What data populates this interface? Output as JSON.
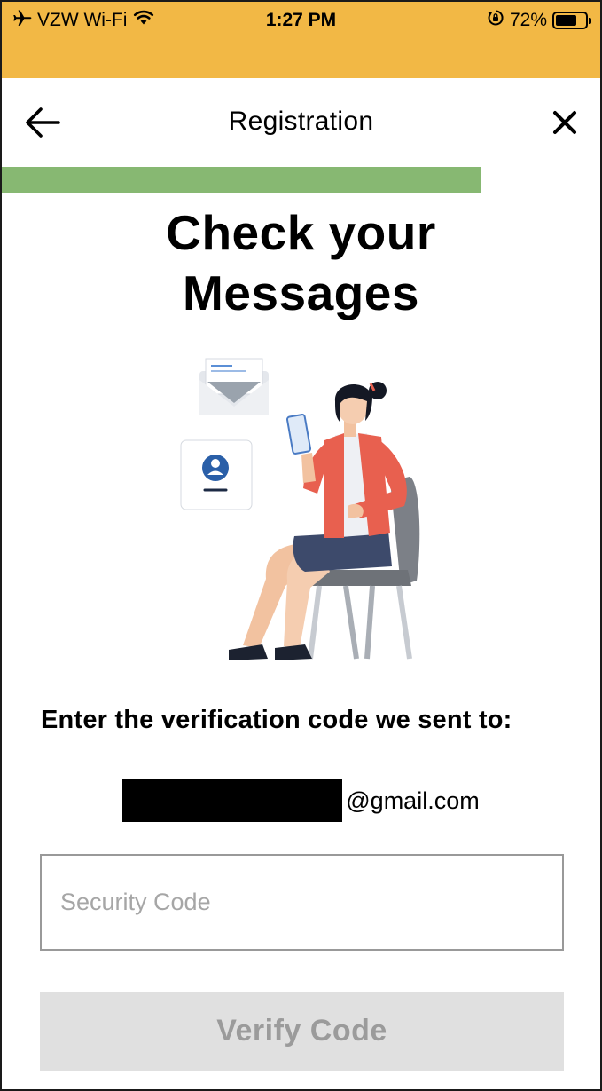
{
  "status_bar": {
    "carrier": "VZW Wi-Fi",
    "time": "1:27 PM",
    "battery_percent": "72%",
    "battery_level": 0.72,
    "icons": [
      "airplane-icon",
      "wifi-icon",
      "rotation-lock-icon",
      "battery-icon"
    ],
    "background_color": "#f2b845"
  },
  "header": {
    "title": "Registration",
    "back_icon": "arrow-left-icon",
    "close_icon": "close-icon"
  },
  "progress": {
    "fraction": 0.8,
    "color": "#87b872"
  },
  "main": {
    "headline_line1": "Check your",
    "headline_line2": "Messages",
    "illustration": "woman-with-phone-illustration",
    "instruction": "Enter the verification code we sent to:",
    "email_suffix": "@gmail.com",
    "code_field": {
      "placeholder": "Security Code",
      "value": ""
    },
    "verify_button_label": "Verify Code"
  }
}
